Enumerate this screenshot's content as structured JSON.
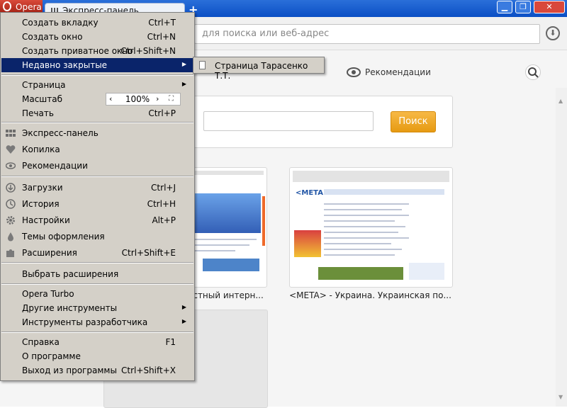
{
  "titlebar": {
    "opera_label": "Opera",
    "tab_title": "Экспресс-панель",
    "new_tab_symbol": "+",
    "minimize_symbol": "▁",
    "maximize_symbol": "❐",
    "close_symbol": "✕"
  },
  "toolbar": {
    "address_placeholder": "для поиска или веб-адрес",
    "download_symbol": "⬇"
  },
  "speed_dial": {
    "recommendations_label": "Рекомендации",
    "search_button": "Поиск",
    "tile1_label": "остный интерн...",
    "tile2_label": "<META> - Украина. Украинская по...",
    "meta_logo": "<META>"
  },
  "menu": {
    "items": [
      {
        "label": "Создать вкладку",
        "shortcut": "Ctrl+T"
      },
      {
        "label": "Создать окно",
        "shortcut": "Ctrl+N"
      },
      {
        "label": "Создать приватное окно",
        "shortcut": "Ctrl+Shift+N"
      },
      {
        "label": "Недавно закрытые",
        "shortcut": ""
      },
      {
        "label": "Страница",
        "shortcut": ""
      },
      {
        "label": "Масштаб",
        "shortcut": ""
      },
      {
        "label": "Печать",
        "shortcut": "Ctrl+P"
      },
      {
        "label": "Экспресс-панель",
        "shortcut": ""
      },
      {
        "label": "Копилка",
        "shortcut": ""
      },
      {
        "label": "Рекомендации",
        "shortcut": ""
      },
      {
        "label": "Загрузки",
        "shortcut": "Ctrl+J"
      },
      {
        "label": "История",
        "shortcut": "Ctrl+H"
      },
      {
        "label": "Настройки",
        "shortcut": "Alt+P"
      },
      {
        "label": "Темы оформления",
        "shortcut": ""
      },
      {
        "label": "Расширения",
        "shortcut": "Ctrl+Shift+E"
      },
      {
        "label": "Выбрать расширения",
        "shortcut": ""
      },
      {
        "label": "Opera Turbo",
        "shortcut": ""
      },
      {
        "label": "Другие инструменты",
        "shortcut": ""
      },
      {
        "label": "Инструменты разработчика",
        "shortcut": ""
      },
      {
        "label": "Справка",
        "shortcut": "F1"
      },
      {
        "label": "О программе",
        "shortcut": ""
      },
      {
        "label": "Выход из программы",
        "shortcut": "Ctrl+Shift+X"
      }
    ],
    "zoom_value": "100%",
    "zoom_decrease": "‹",
    "zoom_increase": "›",
    "zoom_fit": "⛶",
    "submenu_arrow": "▶"
  },
  "submenu": {
    "item": "Страница Тарасенко Т.Т."
  },
  "colors": {
    "menu_bg": "#d4d0c8",
    "menu_highlight": "#0a246a",
    "titlebar": "#0b4fc5",
    "search_button": "#f0a82a"
  }
}
